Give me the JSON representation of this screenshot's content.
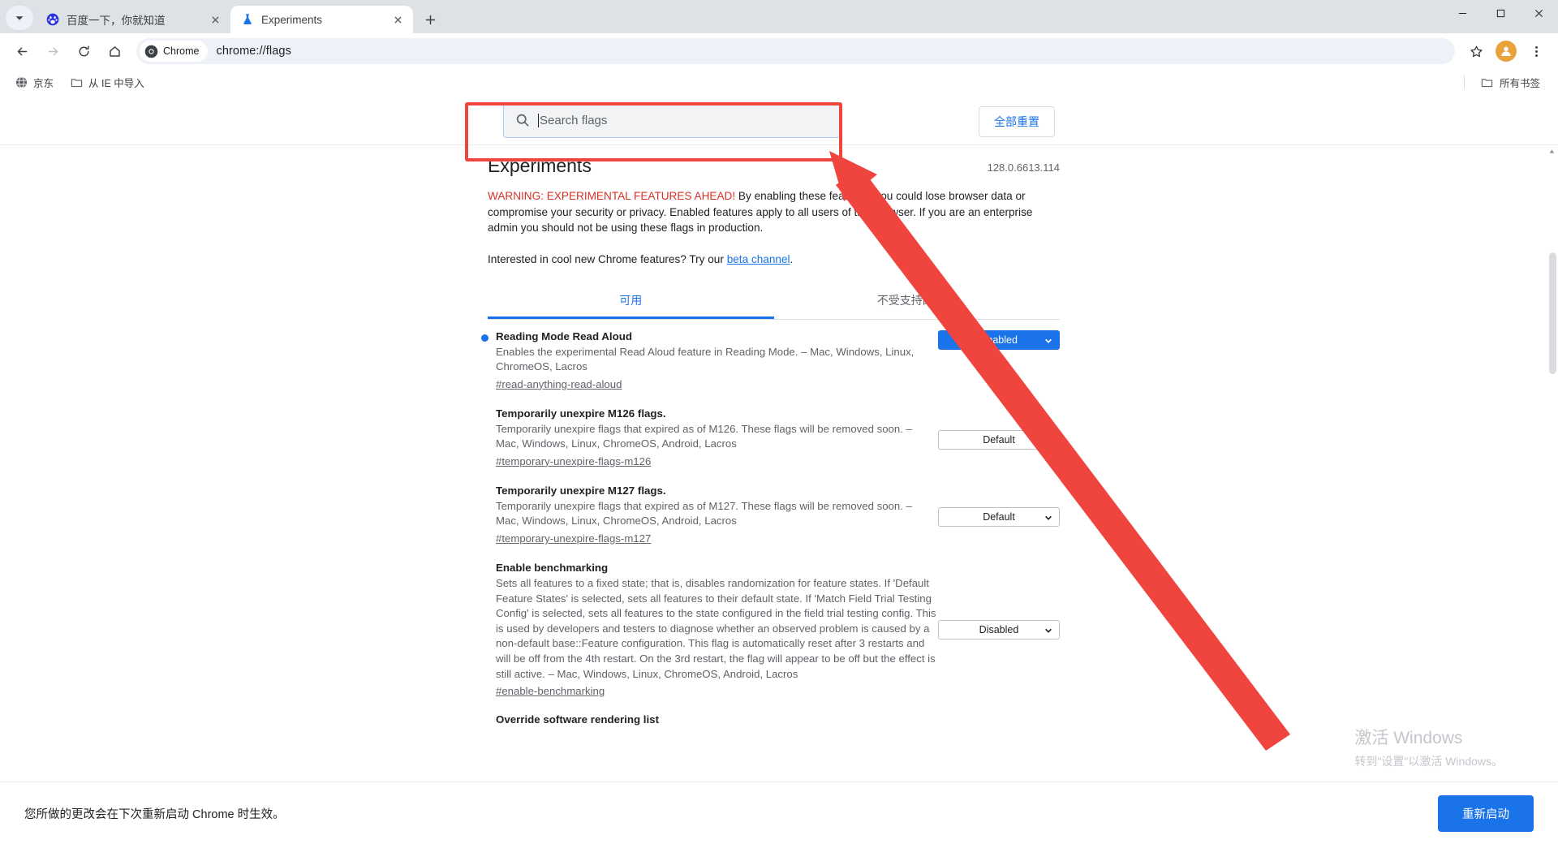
{
  "window": {
    "controls": {
      "minimize": "minimize-icon",
      "maximize": "maximize-icon",
      "close": "close-icon"
    }
  },
  "tabstrip": {
    "tab_search_tooltip": "Search tabs",
    "new_tab_label": "New tab",
    "tabs": [
      {
        "title": "百度一下，你就知道",
        "favicon": "baidu-favicon",
        "active": false
      },
      {
        "title": "Experiments",
        "favicon": "chrome-flags-favicon",
        "active": true
      }
    ]
  },
  "toolbar": {
    "back": "back-icon",
    "forward": "forward-icon",
    "reload": "reload-icon",
    "home": "home-icon",
    "chip_label": "Chrome",
    "url": "chrome://flags",
    "bookmark_star": "star-icon",
    "profile": "profile-avatar",
    "menu": "three-dot-menu-icon"
  },
  "bookmarks": {
    "items": [
      {
        "label": "京东",
        "icon": "globe-icon"
      },
      {
        "label": "从 IE 中导入",
        "icon": "folder-icon"
      }
    ],
    "all_bookmarks_label": "所有书签",
    "all_bookmarks_icon": "folder-icon"
  },
  "flags_page": {
    "search": {
      "placeholder": "Search flags",
      "value": ""
    },
    "reset_all_label": "全部重置",
    "title": "Experiments",
    "version": "128.0.6613.114",
    "warning_strong": "WARNING: EXPERIMENTAL FEATURES AHEAD!",
    "warning_rest": " By enabling these features, you could lose browser data or compromise your security or privacy. Enabled features apply to all users of this browser. If you are an enterprise admin you should not be using these flags in production.",
    "interested_prefix": "Interested in cool new Chrome features? Try our ",
    "beta_link": "beta channel",
    "interested_suffix": ".",
    "tabs": [
      {
        "label": "可用",
        "selected": true
      },
      {
        "label": "不受支持的实验",
        "selected": false
      }
    ],
    "flags": [
      {
        "name": "Reading Mode Read Aloud",
        "description": "Enables the experimental Read Aloud feature in Reading Mode. – Mac, Windows, Linux, ChromeOS, Lacros",
        "permalink": "#read-anything-read-aloud",
        "state": "Enabled",
        "modified": true
      },
      {
        "name": "Temporarily unexpire M126 flags.",
        "description": "Temporarily unexpire flags that expired as of M126. These flags will be removed soon. – Mac, Windows, Linux, ChromeOS, Android, Lacros",
        "permalink": "#temporary-unexpire-flags-m126",
        "state": "Default",
        "modified": false
      },
      {
        "name": "Temporarily unexpire M127 flags.",
        "description": "Temporarily unexpire flags that expired as of M127. These flags will be removed soon. – Mac, Windows, Linux, ChromeOS, Android, Lacros",
        "permalink": "#temporary-unexpire-flags-m127",
        "state": "Default",
        "modified": false
      },
      {
        "name": "Enable benchmarking",
        "description": "Sets all features to a fixed state; that is, disables randomization for feature states. If 'Default Feature States' is selected, sets all features to their default state. If 'Match Field Trial Testing Config' is selected, sets all features to the state configured in the field trial testing config. This is used by developers and testers to diagnose whether an observed problem is caused by a non-default base::Feature configuration. This flag is automatically reset after 3 restarts and will be off from the 4th restart. On the 3rd restart, the flag will appear to be off but the effect is still active. – Mac, Windows, Linux, ChromeOS, Android, Lacros",
        "permalink": "#enable-benchmarking",
        "state": "Disabled",
        "modified": false
      },
      {
        "name": "Override software rendering list",
        "description": "",
        "permalink": "",
        "state": "",
        "modified": false
      }
    ],
    "footer_text": "您所做的更改会在下次重新启动 Chrome 时生效。",
    "restart_label": "重新启动"
  },
  "watermark": {
    "line1": "激活 Windows",
    "line2": "转到\"设置\"以激活 Windows。"
  },
  "annotations": {
    "highlight_box_color": "#f0443e",
    "arrow_color": "#f0443e"
  }
}
